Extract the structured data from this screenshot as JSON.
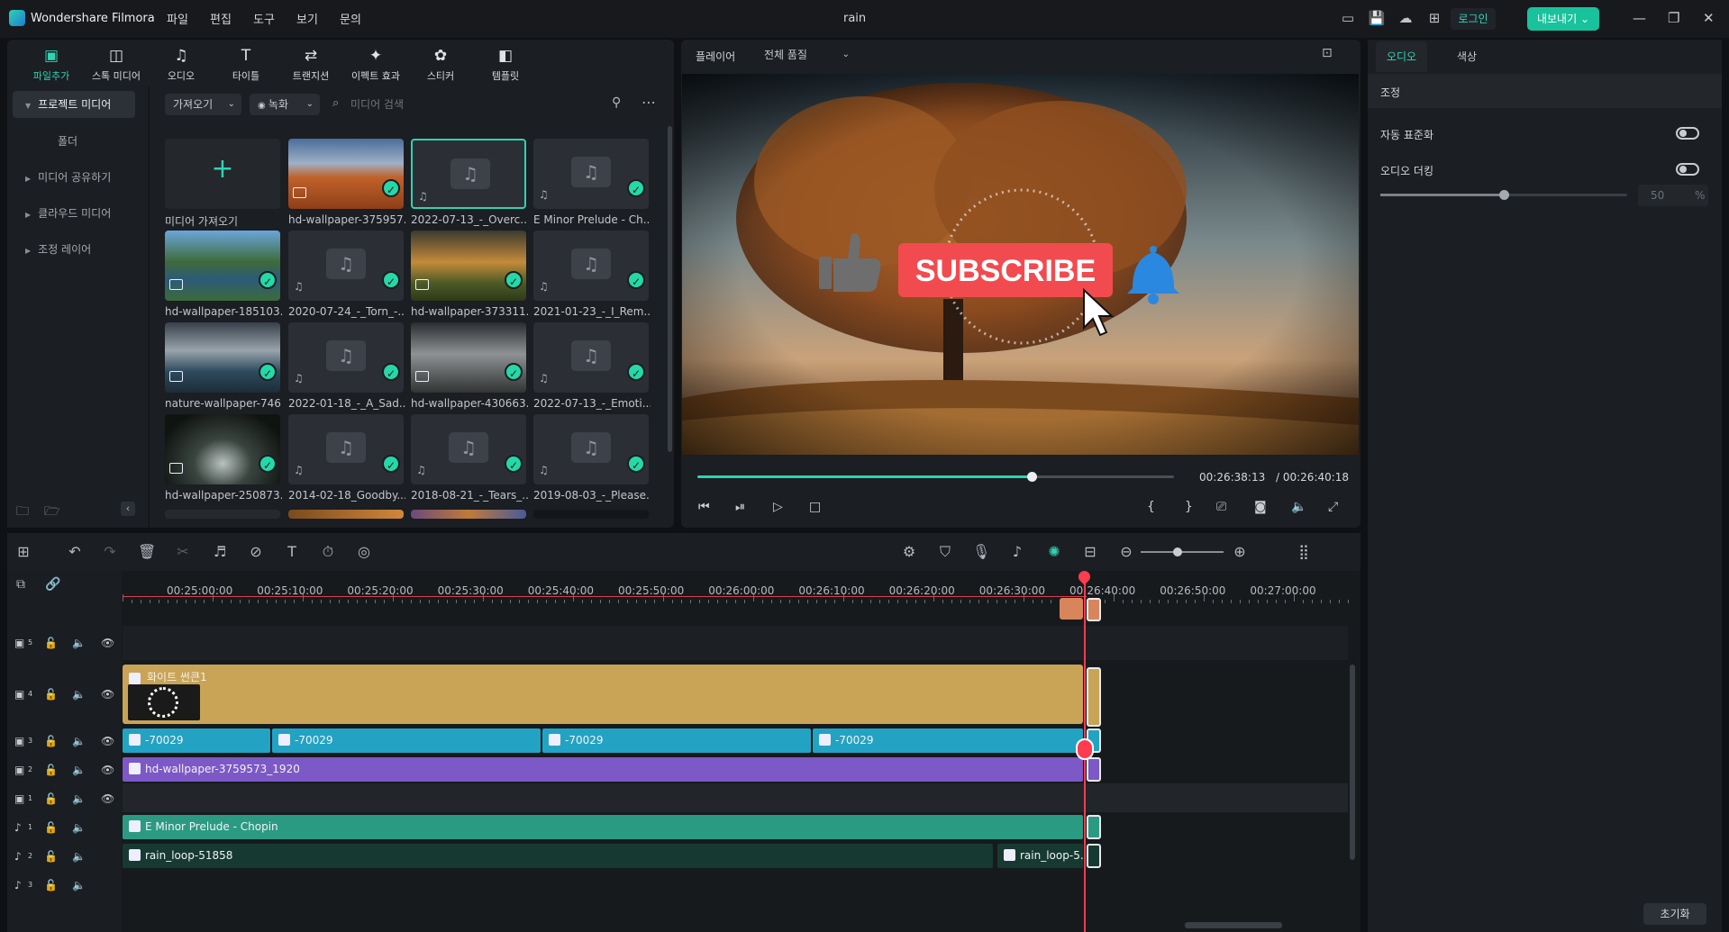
{
  "app": {
    "name": "Wondershare Filmora",
    "project": "rain",
    "menus": [
      "파일",
      "편집",
      "도구",
      "보기",
      "문의"
    ],
    "login": "로그인",
    "export": "내보내기"
  },
  "media_tabs": [
    "파일추가",
    "스톡 미디어",
    "오디오",
    "타이틀",
    "트랜지션",
    "이펙트 효과",
    "스티커",
    "템플릿"
  ],
  "sidebar": {
    "items": [
      "프로젝트 미디어",
      "폴더",
      "미디어 공유하기",
      "클라우드 미디어",
      "조정 레이어"
    ]
  },
  "media_toolbar": {
    "import": "가져오기",
    "record": "녹화",
    "search_placeholder": "미디어 검색"
  },
  "media_items": [
    {
      "label": "미디어 가져오기",
      "kind": "add",
      "check": false
    },
    {
      "label": "hd-wallpaper-375957...",
      "kind": "image-autumn",
      "check": true
    },
    {
      "label": "2022-07-13_-_Overc...",
      "kind": "audio",
      "check": false,
      "selected": true
    },
    {
      "label": "E Minor Prelude - Ch...",
      "kind": "audio",
      "check": true
    },
    {
      "label": "hd-wallpaper-185103...",
      "kind": "image-lake",
      "check": true
    },
    {
      "label": "2020-07-24_-_Torn_-...",
      "kind": "audio",
      "check": true
    },
    {
      "label": "hd-wallpaper-373311...",
      "kind": "image-field",
      "check": true
    },
    {
      "label": "2021-01-23_-_I_Rem...",
      "kind": "audio",
      "check": true
    },
    {
      "label": "nature-wallpaper-746...",
      "kind": "image-sea",
      "check": true
    },
    {
      "label": "2022-01-18_-_A_Sad...",
      "kind": "audio",
      "check": true
    },
    {
      "label": "hd-wallpaper-430663...",
      "kind": "image-storm",
      "check": true
    },
    {
      "label": "2022-07-13_-_Emoti...",
      "kind": "audio",
      "check": true
    },
    {
      "label": "hd-wallpaper-250873...",
      "kind": "image-forest",
      "check": true
    },
    {
      "label": "2014-02-18_Goodby...",
      "kind": "audio",
      "check": true
    },
    {
      "label": "2018-08-21_-_Tears_...",
      "kind": "audio",
      "check": true
    },
    {
      "label": "2019-08-03_-_Please...",
      "kind": "audio",
      "check": true
    }
  ],
  "player": {
    "title": "플레이어",
    "quality": "전체 품질",
    "current_time": "00:26:38:13",
    "total_time": "/ 00:26:40:18",
    "progress": 0.701,
    "subscribe_text": "SUBSCRIBE"
  },
  "right_panel": {
    "tabs": [
      "오디오",
      "색상"
    ],
    "section": "조정",
    "auto_normalize": "자동 표준화",
    "audio_ducking": "오디오 더킹",
    "ducking_value": "50",
    "ducking_unit": "%",
    "ducking_level": 0.5,
    "reset": "초기화"
  },
  "timeline": {
    "ticks": [
      "00:25:00:00",
      "00:25:10:00",
      "00:25:20:00",
      "00:25:30:00",
      "00:25:40:00",
      "00:25:50:00",
      "00:26:00:00",
      "00:26:10:00",
      "00:26:20:00",
      "00:26:30:00",
      "00:26:40:00",
      "00:26:50:00",
      "00:27:00:00"
    ],
    "track_labels": [
      "5",
      "4",
      "3",
      "2",
      "1",
      "1",
      "2",
      "3"
    ],
    "tracks": {
      "v4_label": "화이트 썬큰1",
      "v3_clips": [
        "-70029",
        "-70029",
        "-70029",
        "-70029"
      ],
      "v2_label": "hd-wallpaper-3759573_1920",
      "a1_label": "E Minor Prelude - Chopin",
      "a2_label": "rain_loop-51858",
      "a2_label2": "rain_loop-5..."
    }
  },
  "colors": {
    "accent": "#2fd3b2",
    "playhead": "#ff3b4f",
    "title_clip": "#c9a456",
    "video_clip": "#23a3c3",
    "image_clip": "#7c59c6",
    "audio_clip": "#2b9a83",
    "subscribe": "#f24b4f"
  }
}
